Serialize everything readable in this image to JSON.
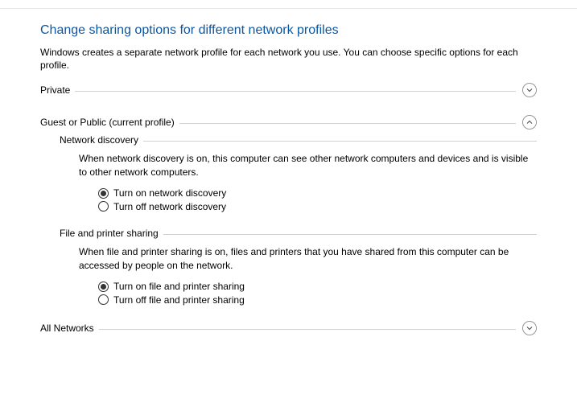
{
  "title": "Change sharing options for different network profiles",
  "description": "Windows creates a separate network profile for each network you use. You can choose specific options for each profile.",
  "sections": {
    "private": {
      "label": "Private",
      "expanded": false
    },
    "guest_public": {
      "label": "Guest or Public (current profile)",
      "expanded": true
    },
    "all_networks": {
      "label": "All Networks",
      "expanded": false
    }
  },
  "network_discovery": {
    "heading": "Network discovery",
    "description": "When network discovery is on, this computer can see other network computers and devices and is visible to other network computers.",
    "options": {
      "on": {
        "label": "Turn on network discovery",
        "checked": true
      },
      "off": {
        "label": "Turn off network discovery",
        "checked": false
      }
    }
  },
  "file_printer": {
    "heading": "File and printer sharing",
    "description": "When file and printer sharing is on, files and printers that you have shared from this computer can be accessed by people on the network.",
    "options": {
      "on": {
        "label": "Turn on file and printer sharing",
        "checked": true
      },
      "off": {
        "label": "Turn off file and printer sharing",
        "checked": false
      }
    }
  }
}
